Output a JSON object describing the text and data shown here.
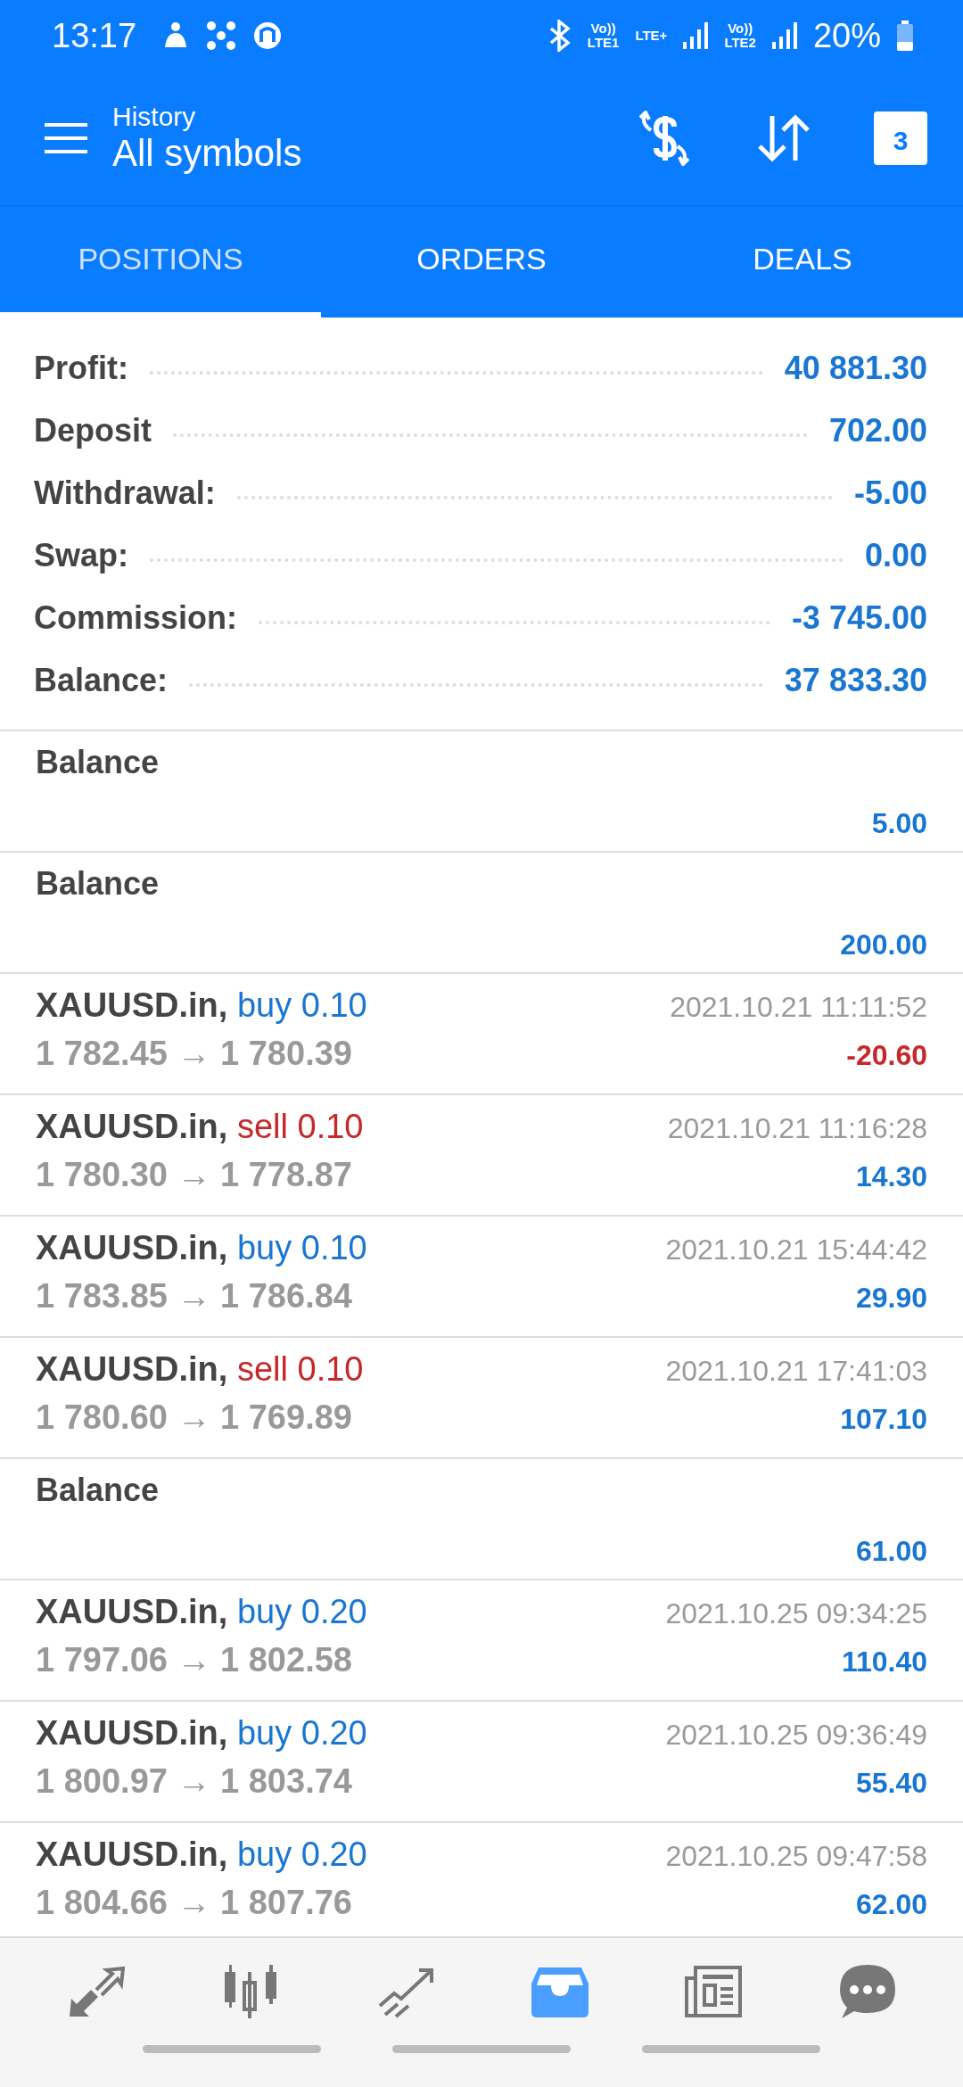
{
  "status_bar": {
    "time": "13:17",
    "network_labels": [
      "Vo))",
      "LTE1",
      "LTE+",
      "Vo))",
      "LTE2"
    ],
    "battery": "20%"
  },
  "header": {
    "subtitle": "History",
    "title": "All symbols",
    "calendar_day": "3"
  },
  "tabs": [
    {
      "label": "POSITIONS",
      "selected": true
    },
    {
      "label": "ORDERS",
      "selected": false
    },
    {
      "label": "DEALS",
      "selected": false
    }
  ],
  "summary": [
    {
      "label": "Profit:",
      "value": "40 881.30"
    },
    {
      "label": "Deposit",
      "value": "702.00"
    },
    {
      "label": "Withdrawal:",
      "value": "-5.00"
    },
    {
      "label": "Swap:",
      "value": "0.00"
    },
    {
      "label": "Commission:",
      "value": "-3 745.00"
    },
    {
      "label": "Balance:",
      "value": "37 833.30"
    }
  ],
  "entries": [
    {
      "kind": "balance",
      "label": "Balance",
      "amount": "5.00"
    },
    {
      "kind": "balance",
      "label": "Balance",
      "amount": "200.00"
    },
    {
      "kind": "trade",
      "symbol": "XAUUSD.in,",
      "side": "buy",
      "lot": "0.10",
      "time": "2021.10.21 11:11:52",
      "prices": "1 782.45 → 1 780.39",
      "amount": "-20.60",
      "negative": true
    },
    {
      "kind": "trade",
      "symbol": "XAUUSD.in,",
      "side": "sell",
      "lot": "0.10",
      "time": "2021.10.21 11:16:28",
      "prices": "1 780.30 → 1 778.87",
      "amount": "14.30",
      "negative": false
    },
    {
      "kind": "trade",
      "symbol": "XAUUSD.in,",
      "side": "buy",
      "lot": "0.10",
      "time": "2021.10.21 15:44:42",
      "prices": "1 783.85 → 1 786.84",
      "amount": "29.90",
      "negative": false
    },
    {
      "kind": "trade",
      "symbol": "XAUUSD.in,",
      "side": "sell",
      "lot": "0.10",
      "time": "2021.10.21 17:41:03",
      "prices": "1 780.60 → 1 769.89",
      "amount": "107.10",
      "negative": false
    },
    {
      "kind": "balance",
      "label": "Balance",
      "amount": "61.00"
    },
    {
      "kind": "trade",
      "symbol": "XAUUSD.in,",
      "side": "buy",
      "lot": "0.20",
      "time": "2021.10.25 09:34:25",
      "prices": "1 797.06 → 1 802.58",
      "amount": "110.40",
      "negative": false
    },
    {
      "kind": "trade",
      "symbol": "XAUUSD.in,",
      "side": "buy",
      "lot": "0.20",
      "time": "2021.10.25 09:36:49",
      "prices": "1 800.97 → 1 803.74",
      "amount": "55.40",
      "negative": false
    },
    {
      "kind": "trade",
      "symbol": "XAUUSD.in,",
      "side": "buy",
      "lot": "0.20",
      "time": "2021.10.25 09:47:58",
      "prices": "1 804.66 → 1 807.76",
      "amount": "62.00",
      "negative": false
    }
  ],
  "bottom_nav": [
    {
      "kind": "quotes",
      "selected": false
    },
    {
      "kind": "chart",
      "selected": false
    },
    {
      "kind": "trade",
      "selected": false
    },
    {
      "kind": "history",
      "selected": true
    },
    {
      "kind": "news",
      "selected": false
    },
    {
      "kind": "chat",
      "selected": false
    }
  ]
}
